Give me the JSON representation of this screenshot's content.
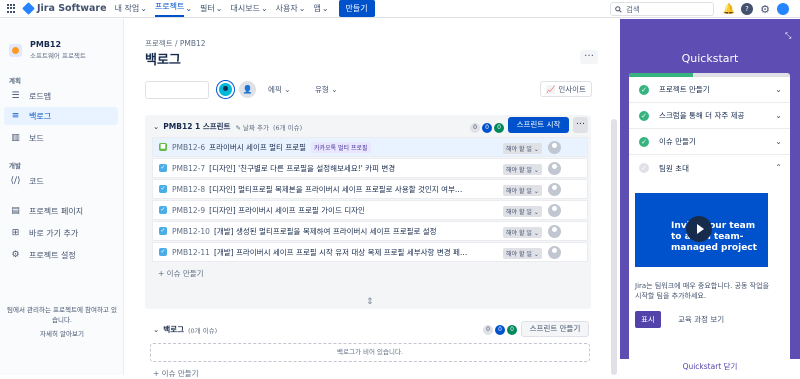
{
  "topnav": {
    "logo": "Jira Software",
    "items": [
      "내 작업",
      "프로젝트",
      "필터",
      "대시보드",
      "사용자",
      "앱"
    ],
    "create": "만들기",
    "search_placeholder": "검색"
  },
  "sidebar": {
    "project_name": "PMB12",
    "project_type": "소프트웨어 프로젝트",
    "plan_label": "계획",
    "roadmap": "로드맵",
    "backlog": "백로그",
    "board": "보드",
    "dev_label": "개발",
    "code": "코드",
    "project_pages": "프로젝트 페이지",
    "add_shortcut": "바로 가기 추가",
    "settings": "프로젝트 설정",
    "footer": "팀에서 관리하는 프로젝트에 참여하고 있습니다.",
    "learn_more": "자세히 알아보기"
  },
  "main": {
    "breadcrumb": "프로젝트 / PMB12",
    "title": "백로그",
    "epic": "에픽",
    "type": "유형",
    "insight": "인사이트"
  },
  "sprint": {
    "name": "PMB12 1 스프린트",
    "add_date": "날짜 추가",
    "count": "(6개 이슈)",
    "counts": [
      "0",
      "0",
      "0"
    ],
    "start": "스프린트 시작",
    "add_issue": "+ 이슈 만들기",
    "issues": [
      {
        "key": "PMB12-6",
        "summary": "프라이버시 세이프 멀티 프로필",
        "label": "카카오톡 멀티 프로필",
        "status": "해야 할 일"
      },
      {
        "key": "PMB12-7",
        "summary": "[디자인] '친구별로 다른 프로필을 설정해보세요!' 카피 변경",
        "label": "",
        "status": "해야 할 일"
      },
      {
        "key": "PMB12-8",
        "summary": "[디자인] 멀티프로필 복제본을 프라이버시 세이프 프로필로 사용할 것인지 여부를 묻는 ...",
        "label": "",
        "status": "해야 할 일"
      },
      {
        "key": "PMB12-9",
        "summary": "[디자인] 프라이버시 세이프 프로필 가이드 디자인",
        "label": "",
        "status": "해야 할 일"
      },
      {
        "key": "PMB12-10",
        "summary": "[개발] 생성된 멀티프로필을 복제하여 프라이버시 세이프 프로필로 설정",
        "label": "",
        "status": "해야 할 일"
      },
      {
        "key": "PMB12-11",
        "summary": "[개발] 프라이버시 세이프 프로필 시작 유저 대상 복제 프로필 세부사항 변경 페이지 제...",
        "label": "",
        "status": "해야 할 일"
      }
    ]
  },
  "backlog": {
    "name": "백로그",
    "count": "(0개 이슈)",
    "counts": [
      "0",
      "0",
      "0"
    ],
    "create_sprint": "스프린트 만들기",
    "empty": "백로그가 비어 있습니다.",
    "add_issue": "+ 이슈 만들기"
  },
  "quickstart": {
    "title": "Quickstart",
    "progress": 0.4,
    "items": [
      "프로젝트 만들기",
      "스크럼을 통해 더 자주 제공",
      "이슈 만들기",
      "팀원 초대"
    ],
    "video_text": "Invite your team to a Jira team-managed project",
    "desc": "Jira는 팀워크에 매우 중요합니다. 공동 작업을 시작할 팀을 추가하세요.",
    "show": "표시",
    "learn": "교육 과정 보기",
    "close": "Quickstart 닫기"
  },
  "colors": {
    "accent": "#0052cc",
    "quickstart_bg": "#5e4db2",
    "done": "#36b37e"
  }
}
